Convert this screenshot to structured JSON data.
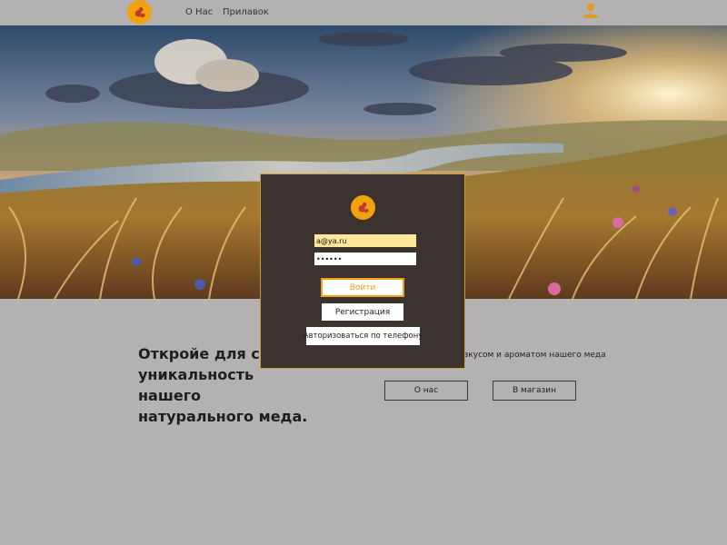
{
  "header": {
    "logo_icon": "squirrel-logo-icon",
    "nav": [
      {
        "label": "О Нас"
      },
      {
        "label": "Прилавок"
      }
    ],
    "user_icon": "user-icon"
  },
  "hero": {
    "image": "sunset-meadow-river-landscape"
  },
  "content": {
    "headline": "Откройе для себя уникальность нашего натурального меда.",
    "subtext": "вкусом и ароматом нашего меда",
    "about_button": "О нас",
    "shop_button": "В магазин"
  },
  "login_modal": {
    "logo_icon": "squirrel-logo-icon",
    "email_value": "a@ya.ru",
    "password_value": "••••••",
    "login_button": "Войти",
    "register_button": "Регистрация",
    "phone_button": "Авторизоваться по телефону"
  },
  "colors": {
    "accent": "#f2a20e",
    "background": "#b3b1b2",
    "modal_bg": "#3c3230"
  }
}
